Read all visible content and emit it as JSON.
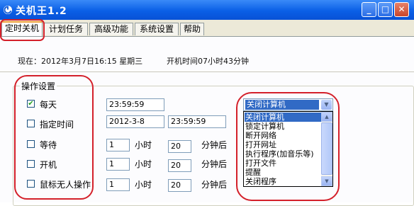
{
  "window": {
    "title": "关机王1.2",
    "controls": {
      "minimize": "_",
      "maximize": "□",
      "close": "✕"
    }
  },
  "tabs": [
    "定时关机",
    "计划任务",
    "高级功能",
    "系统设置",
    "帮助"
  ],
  "active_tab": "定时关机",
  "status": {
    "now": "现在：2012年3月7日16:15 星期三",
    "uptime": "开机时间07小时43分钟"
  },
  "group": {
    "label": "操作设置",
    "rows": [
      {
        "label": "每天",
        "checked": true,
        "check_mark": "✔",
        "time": "23:59:59"
      },
      {
        "label": "指定时间",
        "checked": false,
        "date": "2012-3-8",
        "time": "23:59:59"
      },
      {
        "label": "等待",
        "checked": false,
        "hours": "1",
        "hours_unit": "小时",
        "minutes": "20",
        "minutes_unit": "分钟后"
      },
      {
        "label": "开机",
        "checked": false,
        "hours": "1",
        "hours_unit": "小时",
        "minutes": "20",
        "minutes_unit": "分钟后"
      },
      {
        "label": "鼠标无人操作",
        "checked": false,
        "hours": "1",
        "hours_unit": "小时",
        "minutes": "20",
        "minutes_unit": "分钟后"
      }
    ]
  },
  "action_select": {
    "selected": "关闭计算机",
    "options": [
      "关闭计算机",
      "锁定计算机",
      "断开网络",
      "打开网址",
      "执行程序(加音乐等)",
      "打开文件",
      "提醒",
      "关闭程序"
    ]
  },
  "colors": {
    "titlebar": "#0a5fe6",
    "selection": "#316ac5",
    "annotation": "#d4202a",
    "active_tab_accent": "#f0a33f"
  }
}
